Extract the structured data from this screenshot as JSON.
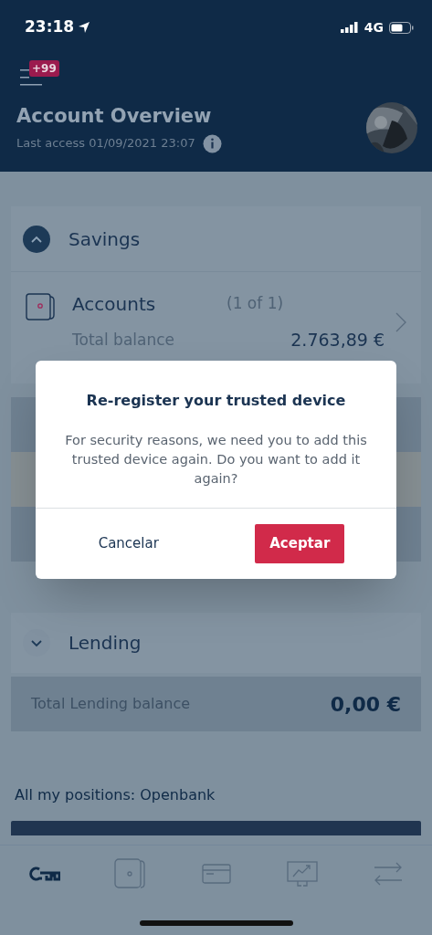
{
  "status_bar": {
    "time": "23:18",
    "network": "4G"
  },
  "header": {
    "notification_badge": "+99",
    "title": "Account Overview",
    "last_access": "Last access 01/09/2021 23:07"
  },
  "sections": [
    {
      "title": "Savings",
      "expanded": true,
      "products": [
        {
          "name": "Accounts",
          "count": "(1 of 1)",
          "balance_label": "Total balance",
          "balance": "2.763,89 €"
        }
      ]
    },
    {
      "title": "Lending",
      "expanded": false,
      "total_label": "Total Lending balance",
      "total": "0,00 €"
    }
  ],
  "positions_label": "All my positions: Openbank",
  "dialog": {
    "title": "Re-register your trusted device",
    "message": "For security reasons, we need you to add this trusted device again. Do you want to add it again?",
    "buttons": [
      {
        "label": "Cancelar",
        "kind": "secondary"
      },
      {
        "label": "Aceptar",
        "kind": "primary"
      }
    ]
  },
  "tabs": [
    {
      "kind": "key",
      "selected": true
    },
    {
      "kind": "wallet",
      "selected": false
    },
    {
      "kind": "card",
      "selected": false
    },
    {
      "kind": "chart",
      "selected": false
    },
    {
      "kind": "transfer",
      "selected": false
    }
  ]
}
